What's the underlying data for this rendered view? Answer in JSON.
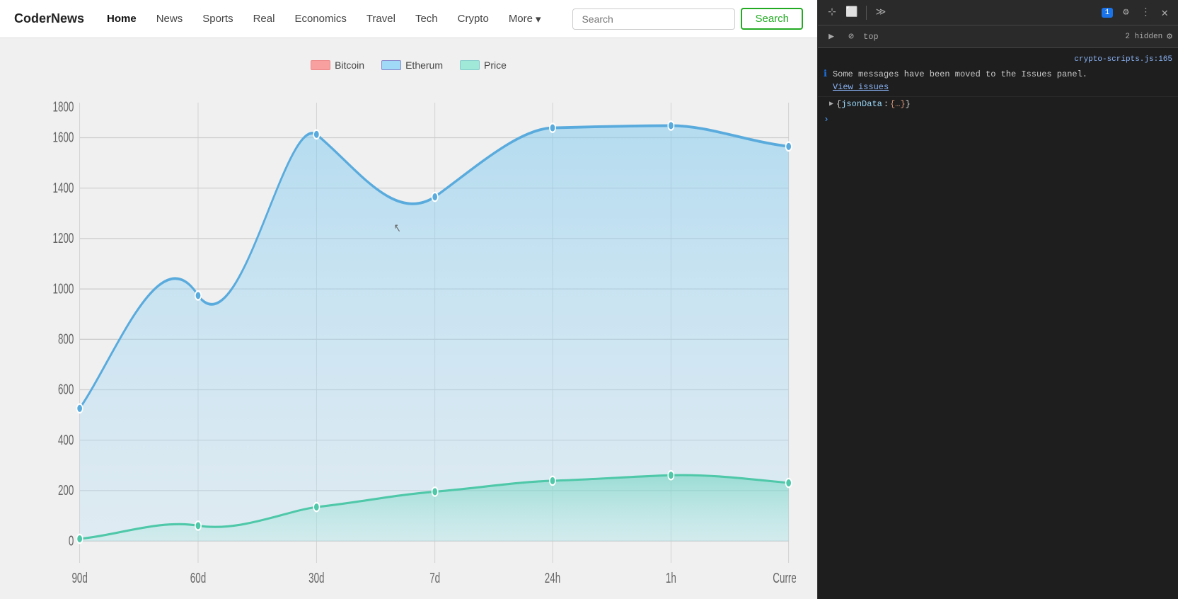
{
  "navbar": {
    "brand": "CoderNews",
    "links": [
      {
        "label": "Home",
        "active": true
      },
      {
        "label": "News",
        "active": false
      },
      {
        "label": "Sports",
        "active": false
      },
      {
        "label": "Real",
        "active": false
      },
      {
        "label": "Economics",
        "active": false
      },
      {
        "label": "Travel",
        "active": false
      },
      {
        "label": "Tech",
        "active": false
      },
      {
        "label": "Crypto",
        "active": false
      }
    ],
    "more_label": "More",
    "search_placeholder": "Search",
    "search_button": "Search"
  },
  "chart": {
    "legend": [
      {
        "id": "bitcoin",
        "label": "Bitcoin",
        "color": "#f8a0a0"
      },
      {
        "id": "etherum",
        "label": "Etherum",
        "color": "#a0d8f8"
      },
      {
        "id": "price",
        "label": "Price",
        "color": "#a0e8d8"
      }
    ],
    "x_labels": [
      "90d",
      "60d",
      "30d",
      "7d",
      "24h",
      "1h",
      "Current"
    ],
    "y_labels": [
      "1800",
      "1600",
      "1400",
      "1200",
      "1000",
      "800",
      "600",
      "400",
      "200",
      "0"
    ],
    "etherum_data": [
      575,
      1065,
      1760,
      1490,
      1790,
      1800,
      1710
    ],
    "price_data": [
      10,
      65,
      145,
      215,
      260,
      285,
      250
    ]
  },
  "devtools": {
    "toolbar": {
      "badge_count": "1",
      "hidden_count": "2 hidden"
    },
    "filter_text": "top",
    "message": {
      "text": "Some messages have been moved to the Issues panel.",
      "link_text": "View issues"
    },
    "source_file": "crypto-scripts.js:165",
    "object_key": "jsonData",
    "object_val": "{…}"
  }
}
